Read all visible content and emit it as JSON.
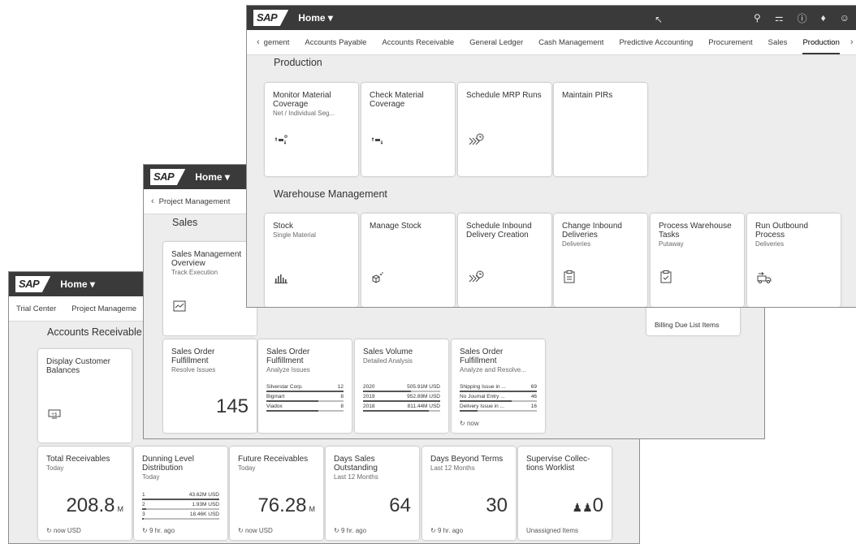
{
  "shell": {
    "logo": "SAP",
    "home": "Home ▾"
  },
  "win1": {
    "tabs": [
      "Trial Center",
      "Project Manageme"
    ],
    "section": "Accounts Receivable",
    "tile_display": {
      "title": "Display Customer Balances"
    },
    "tile_total": {
      "title": "Total Receivables",
      "sub": "Today",
      "value": "208.8",
      "unit": "M",
      "foot": "now  USD"
    },
    "tile_dunning": {
      "title": "Dunning Level Distribution",
      "sub": "Today",
      "rows": [
        {
          "k": "1",
          "v": "43.62M USD",
          "p": 1.0
        },
        {
          "k": "2",
          "v": "1.93M USD",
          "p": 0.05
        },
        {
          "k": "3",
          "v": "18.46K USD",
          "p": 0.01
        }
      ],
      "foot": "9 hr. ago"
    },
    "tile_future": {
      "title": "Future Receivables",
      "sub": "Today",
      "value": "76.28",
      "unit": "M",
      "foot": "now  USD"
    },
    "tile_dso": {
      "title": "Days Sales Outstanding",
      "sub": "Last 12 Months",
      "value": "64",
      "foot": "9 hr. ago"
    },
    "tile_dbt": {
      "title": "Days Beyond Terms",
      "sub": "Last 12 Months",
      "value": "30",
      "foot": "9 hr. ago"
    },
    "tile_collect": {
      "title": "Supervise Collec- tions Worklist",
      "value": "0",
      "foot": "Unassigned Items"
    }
  },
  "win2": {
    "tabs": [
      "Project Management"
    ],
    "section": "Sales",
    "tile_smo": {
      "title": "Sales Management Overview",
      "sub": "Track Execution"
    },
    "billing": "Billing Due List Items",
    "tile_sof1": {
      "title": "Sales Order Fulfillment",
      "sub": "Resolve Issues",
      "value": "145"
    },
    "tile_sof2": {
      "title": "Sales Order Fulfillment",
      "sub": "Analyze Issues",
      "rows": [
        {
          "k": "Silverstar Corp.",
          "v": "12",
          "p": 1.0
        },
        {
          "k": "Bigmart",
          "v": "8",
          "p": 0.67
        },
        {
          "k": "Viadox",
          "v": "8",
          "p": 0.67
        }
      ]
    },
    "tile_sv": {
      "title": "Sales Volume",
      "sub": "Detailed Analysis",
      "rows": [
        {
          "k": "2020",
          "v": "505.91M USD",
          "p": 0.62
        },
        {
          "k": "2019",
          "v": "952.89M USD",
          "p": 1.0
        },
        {
          "k": "2018",
          "v": "811.44M USD",
          "p": 0.85
        }
      ]
    },
    "tile_sof3": {
      "title": "Sales Order Fulfillment",
      "sub": "Analyze and Resolve...",
      "rows": [
        {
          "k": "Shipping Issue in ...",
          "v": "69",
          "p": 1.0
        },
        {
          "k": "No Journal Entry ...",
          "v": "46",
          "p": 0.67
        },
        {
          "k": "Delivery Issue in ...",
          "v": "16",
          "p": 0.23
        }
      ],
      "foot": "now"
    }
  },
  "win3": {
    "tabs": [
      "gement",
      "Accounts Payable",
      "Accounts Receivable",
      "General Ledger",
      "Cash Management",
      "Predictive Accounting",
      "Procurement",
      "Sales",
      "Production"
    ],
    "section1": "Production",
    "section2": "Warehouse Management",
    "prod": [
      {
        "title": "Monitor Material Coverage",
        "sub": "Net / Individual Seg..."
      },
      {
        "title": "Check Material Coverage",
        "sub": ""
      },
      {
        "title": "Schedule MRP Runs",
        "sub": ""
      },
      {
        "title": "Maintain PIRs",
        "sub": ""
      }
    ],
    "wh": [
      {
        "title": "Stock",
        "sub": "Single Material"
      },
      {
        "title": "Manage Stock",
        "sub": ""
      },
      {
        "title": "Schedule Inbound Delivery Creation",
        "sub": ""
      },
      {
        "title": "Change Inbound Deliveries",
        "sub": "Deliveries"
      },
      {
        "title": "Process Warehouse Tasks",
        "sub": "Putaway"
      },
      {
        "title": "Run Outbound Process",
        "sub": "Deliveries"
      }
    ]
  }
}
